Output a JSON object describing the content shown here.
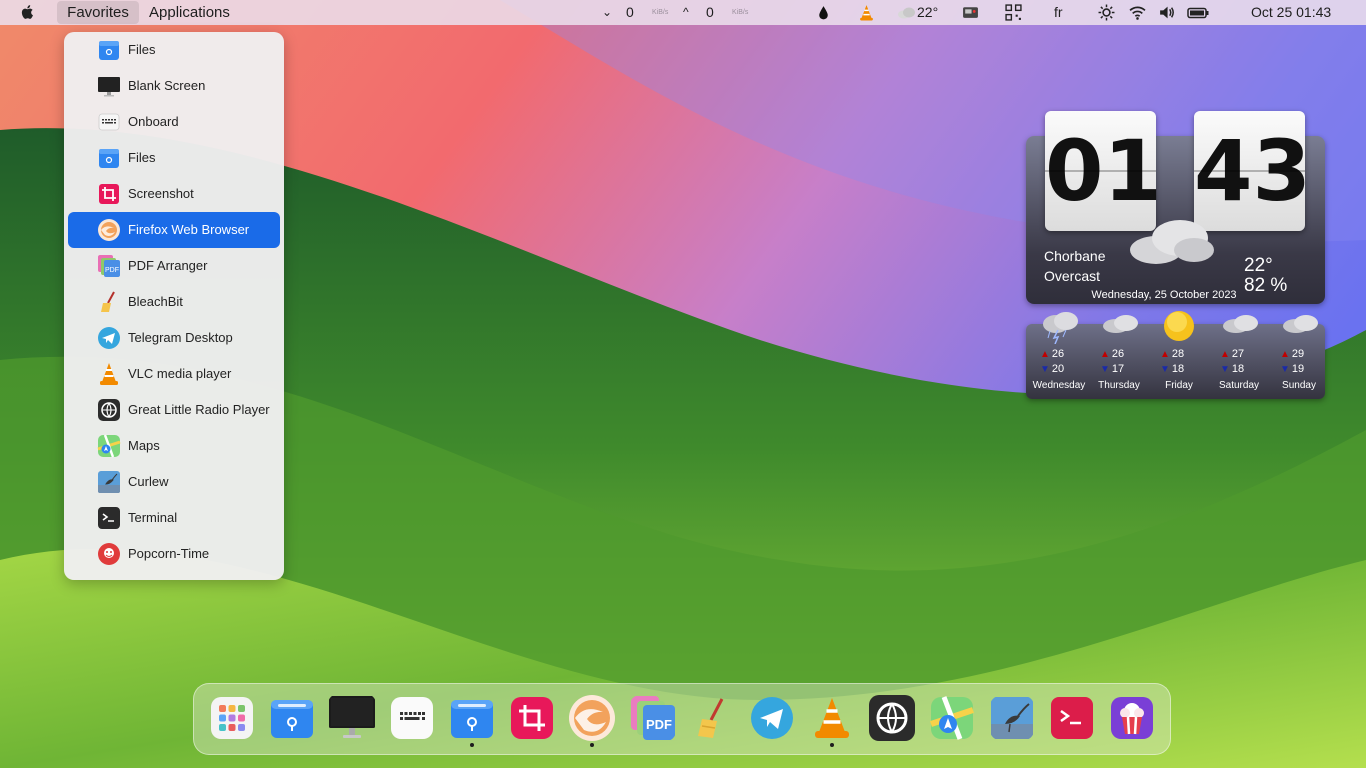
{
  "topbar": {
    "menus": [
      {
        "label": "Favorites"
      },
      {
        "label": "Applications"
      }
    ],
    "net_down_value": "0",
    "net_down_unit": "KiB/s",
    "net_up_value": "0",
    "net_up_unit": "KiB/s",
    "net_down_arrow": "⌄",
    "net_up_arrow": "^",
    "weather_temp": "22°",
    "keyboard_layout": "fr",
    "datetime": "Oct 25  01:43"
  },
  "favorites_menu": {
    "items": [
      {
        "label": "Files",
        "icon": "files-icon"
      },
      {
        "label": "Blank Screen",
        "icon": "monitor-icon"
      },
      {
        "label": "Onboard",
        "icon": "keyboard-icon"
      },
      {
        "label": "Files",
        "icon": "files-icon"
      },
      {
        "label": "Screenshot",
        "icon": "crop-icon"
      },
      {
        "label": "Firefox Web Browser",
        "icon": "firefox-icon",
        "selected": true
      },
      {
        "label": "PDF Arranger",
        "icon": "pdf-icon"
      },
      {
        "label": "BleachBit",
        "icon": "broom-icon"
      },
      {
        "label": "Telegram Desktop",
        "icon": "telegram-icon"
      },
      {
        "label": "VLC media player",
        "icon": "vlc-icon"
      },
      {
        "label": "Great Little Radio Player",
        "icon": "radio-globe-icon"
      },
      {
        "label": "Maps",
        "icon": "maps-icon"
      },
      {
        "label": "Curlew",
        "icon": "curlew-icon"
      },
      {
        "label": "Terminal",
        "icon": "terminal-icon"
      },
      {
        "label": "Popcorn-Time",
        "icon": "popcorn-icon"
      }
    ]
  },
  "weather_widget": {
    "clock_hours": "01",
    "clock_minutes": "43",
    "location": "Chorbane",
    "condition": "Overcast",
    "temperature": "22°",
    "humidity": "82 %",
    "date": "Wednesday, 25 October 2023",
    "forecast": [
      {
        "day": "Wednesday",
        "high": "26",
        "low": "20",
        "icon": "thunderstorm-icon"
      },
      {
        "day": "Thursday",
        "high": "26",
        "low": "17",
        "icon": "cloud-icon"
      },
      {
        "day": "Friday",
        "high": "28",
        "low": "18",
        "icon": "sun-icon"
      },
      {
        "day": "Saturday",
        "high": "27",
        "low": "18",
        "icon": "cloud-icon"
      },
      {
        "day": "Sunday",
        "high": "29",
        "low": "19",
        "icon": "cloud-icon"
      }
    ]
  },
  "dock": {
    "items": [
      {
        "icon": "app-grid-icon",
        "running": false
      },
      {
        "icon": "files-icon",
        "running": false
      },
      {
        "icon": "monitor-icon",
        "running": false
      },
      {
        "icon": "keyboard-icon",
        "running": false
      },
      {
        "icon": "files-icon",
        "running": true
      },
      {
        "icon": "crop-icon",
        "running": false
      },
      {
        "icon": "firefox-icon",
        "running": true
      },
      {
        "icon": "pdf-icon",
        "running": false
      },
      {
        "icon": "broom-icon",
        "running": false
      },
      {
        "icon": "telegram-icon",
        "running": false
      },
      {
        "icon": "vlc-icon",
        "running": true
      },
      {
        "icon": "radio-globe-icon",
        "running": false
      },
      {
        "icon": "maps-icon",
        "running": false
      },
      {
        "icon": "curlew-icon",
        "running": false
      },
      {
        "icon": "terminal-icon",
        "running": false
      },
      {
        "icon": "popcorn-icon",
        "running": false
      }
    ]
  },
  "colors": {
    "accent": "#1a6be8",
    "topbar": "#eadeec",
    "menu_bg": "#f0eef0"
  }
}
